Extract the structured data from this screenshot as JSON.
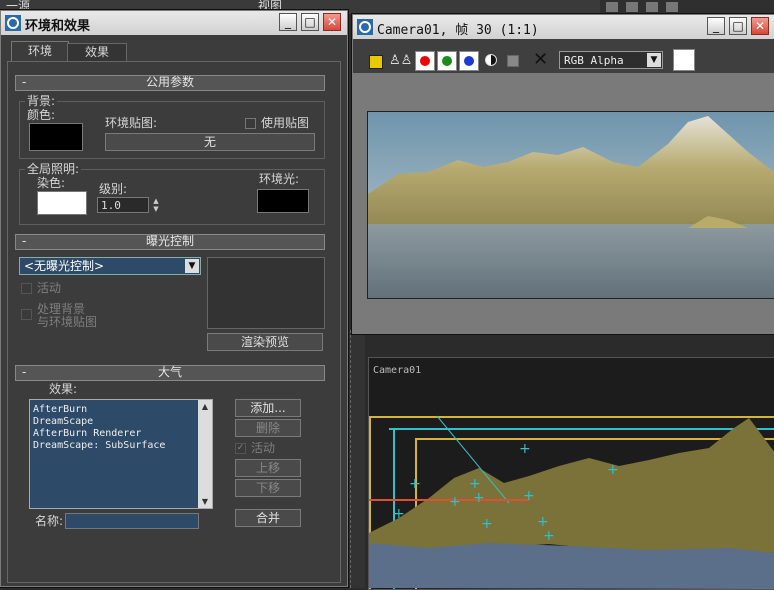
{
  "env_dialog": {
    "title": "环境和效果",
    "tabs": [
      "环境",
      "效果"
    ],
    "common_params": {
      "header": "公用参数",
      "background_group": "背景:",
      "color_label": "颜色:",
      "env_map_label": "环境贴图:",
      "use_map_label": "使用贴图",
      "env_map_button": "无",
      "global_lighting_group": "全局照明:",
      "tint_label": "染色:",
      "level_label": "级别:",
      "level_value": "1.0",
      "ambient_label": "环境光:"
    },
    "exposure": {
      "header": "曝光控制",
      "dropdown_value": "<无曝光控制>",
      "active_label": "活动",
      "process_bg_label": "处理背景",
      "process_bg_label2": "与环境贴图",
      "render_preview_button": "渲染预览"
    },
    "atmosphere": {
      "header": "大气",
      "effects_label": "效果:",
      "effects_list": [
        "AfterBurn",
        "DreamScape",
        "AfterBurn Renderer",
        "DreamScape: SubSurface"
      ],
      "add_button": "添加...",
      "delete_button": "删除",
      "active_label": "活动",
      "move_up_button": "上移",
      "move_down_button": "下移",
      "name_label": "名称:",
      "merge_button": "合并"
    }
  },
  "frame_window": {
    "title": "Camera01, 帧 30 (1:1)",
    "channel_dropdown": "RGB Alpha"
  },
  "viewport": {
    "label": "Camera01"
  },
  "background_ui": {
    "menu_fragment": "视图",
    "toolbar_fragment": "一源"
  },
  "colors": {
    "background_color": "#000000",
    "tint_color": "#ffffff",
    "ambient_color": "#000000",
    "list_bg": "#2d4a68",
    "viewport_gold": "#d4b43a",
    "viewport_cyan": "#34c0c8"
  }
}
